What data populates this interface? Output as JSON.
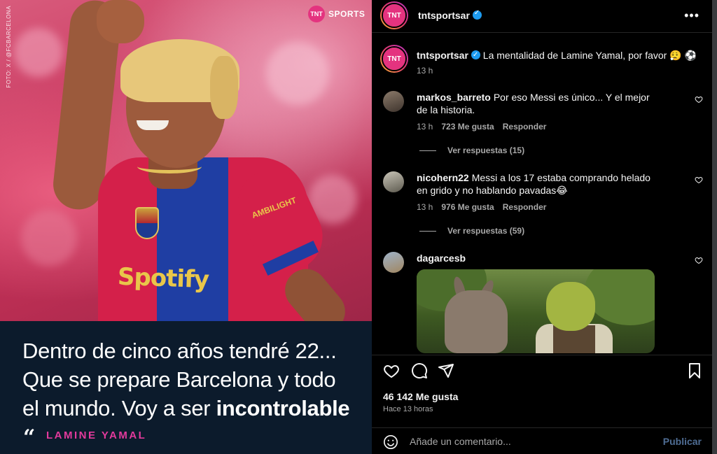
{
  "post": {
    "photo_credit": "FOTO: X / @FCBARCELONA",
    "brand_mark": "TNT",
    "brand_word": "SPORTS",
    "jersey_sponsor": "Spotify",
    "jersey_sleeve": "AMBILIGHT",
    "quote_line_1": "Dentro de cinco años tendré 22...",
    "quote_line_2": "Que se prepare Barcelona y todo",
    "quote_line_3_pre": "el mundo. Voy a ser ",
    "quote_line_3_bold": "incontrolable",
    "quote_mark": "“",
    "quote_author": "LAMINE YAMAL"
  },
  "header": {
    "avatar_text": "TNT",
    "username": "tntsportsar",
    "more_label": "•••"
  },
  "caption": {
    "username": "tntsportsar",
    "text": "La mentalidad de Lamine Yamal, por favor 😮‍💨 ⚽",
    "time": "13 h"
  },
  "comments": [
    {
      "username": "markos_barreto",
      "text": "Por eso Messi es único... Y el mejor de la historia.",
      "time": "13 h",
      "likes": "723 Me gusta",
      "reply": "Responder",
      "replies_label": "Ver respuestas (15)"
    },
    {
      "username": "nicohern22",
      "text": "Messi a los 17 estaba comprando helado en grido y no hablando pavadas😂",
      "time": "13 h",
      "likes": "976 Me gusta",
      "reply": "Responder",
      "replies_label": "Ver respuestas (59)"
    },
    {
      "username": "dagarcesb",
      "text": ""
    }
  ],
  "footer": {
    "likes": "46 142 Me gusta",
    "time": "Hace 13 horas",
    "comment_placeholder": "Añade un comentario...",
    "publish_label": "Publicar"
  },
  "colors": {
    "quote_panel": "#0c1b2c",
    "author_accent": "#e23a9c",
    "brand_pink": "#e4337f",
    "publish_disabled": "#4f6d94"
  }
}
